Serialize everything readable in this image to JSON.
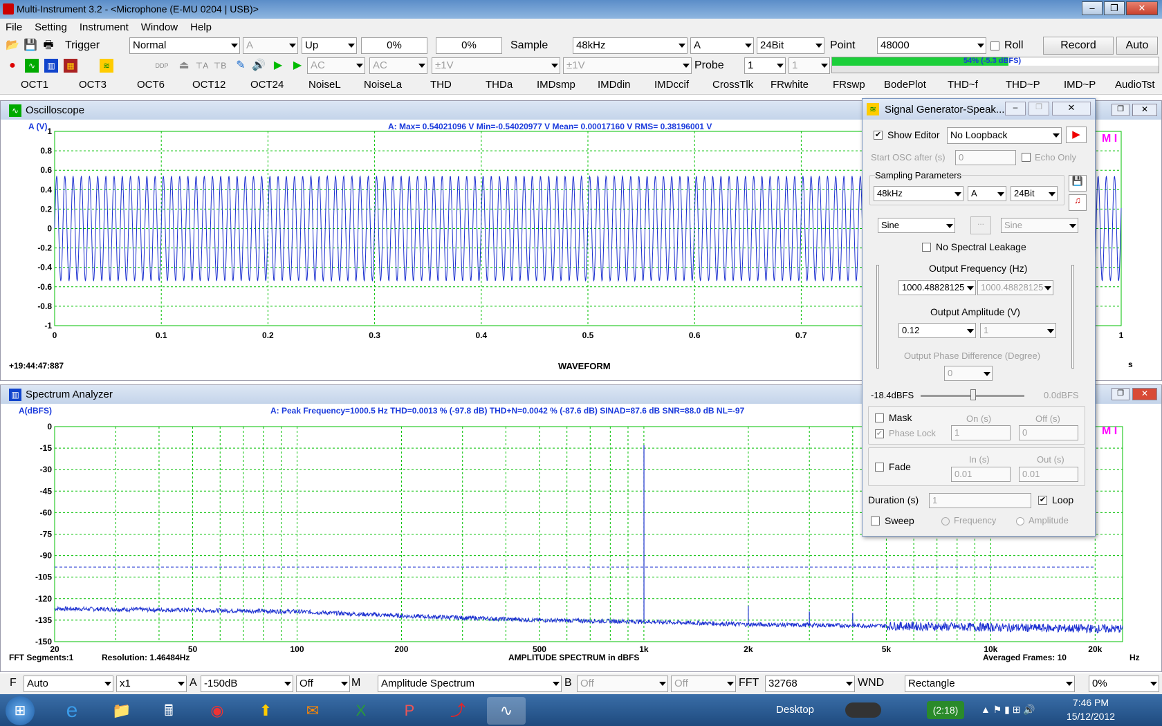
{
  "window": {
    "title": "Multi-Instrument 3.2   -   <Microphone (E-MU 0204 | USB)>"
  },
  "menu": [
    "File",
    "Setting",
    "Instrument",
    "Window",
    "Help"
  ],
  "toolbar1": {
    "trigger_label": "Trigger",
    "mode": "Normal",
    "channel": "A",
    "edge": "Up",
    "pct1": "0%",
    "pct2": "0%",
    "sample_label": "Sample",
    "sample_rate": "48kHz",
    "ch": "A",
    "bits": "24Bit",
    "point_label": "Point",
    "points": "48000",
    "roll_label": "Roll",
    "record_label": "Record",
    "auto_label": "Auto"
  },
  "toolbar2": {
    "coupling1": "AC",
    "coupling2": "AC",
    "range1": "±1V",
    "range2": "±1V",
    "probe_label": "Probe",
    "probe1": "1",
    "probe2": "1",
    "level_text": "54% (-5.3 dBFS)",
    "level": 0.54
  },
  "tabs": [
    "OCT1",
    "OCT3",
    "OCT6",
    "OCT12",
    "OCT24",
    "NoiseL",
    "NoiseLa",
    "THD",
    "THDa",
    "IMDsmp",
    "IMDdin",
    "IMDccif",
    "CrossTlk",
    "FRwhite",
    "FRswp",
    "BodePlot",
    "THD~f",
    "THD~P",
    "IMD~P",
    "AudioTst"
  ],
  "osc": {
    "title": "Oscilloscope",
    "yunit": "A (V)",
    "stats": "A: Max= 0.54021096 V   Min=-0.54020977 V   Mean= 0.00017160 V   RMS= 0.38196001 V",
    "timestamp": "+19:44:47:887",
    "xlabel": "WAVEFORM",
    "xunit": "s",
    "mi": "M I",
    "yticks": [
      "1",
      "0.8",
      "0.6",
      "0.4",
      "0.2",
      "0",
      "-0.2",
      "-0.4",
      "-0.6",
      "-0.8",
      "-1"
    ],
    "xticks": [
      "0",
      "0.1",
      "0.2",
      "0.3",
      "0.4",
      "0.5",
      "0.6",
      "0.7",
      "1"
    ]
  },
  "spec": {
    "title": "Spectrum Analyzer",
    "yunit": "A(dBFS)",
    "stats": "A: Peak Frequency=1000.5 Hz   THD=0.0013 % (-97.8 dB)   THD+N=0.0042 % (-87.6 dB)   SINAD=87.6 dB   SNR=88.0 dB   NL=-97",
    "fft_segments": "FFT Segments:1",
    "resolution": "Resolution: 1.46484Hz",
    "xlabel": "AMPLITUDE SPECTRUM in dBFS",
    "averaged": "Averaged Frames: 10",
    "xunit": "Hz",
    "mi": "M I",
    "yticks": [
      "0",
      "-15",
      "-30",
      "-45",
      "-60",
      "-75",
      "-90",
      "-105",
      "-120",
      "-135",
      "-150"
    ],
    "xticks": [
      "20",
      "50",
      "100",
      "200",
      "500",
      "1k",
      "2k",
      "5k",
      "10k",
      "20k"
    ]
  },
  "chart_data": [
    {
      "type": "line",
      "title": "WAVEFORM",
      "ylabel": "A (V)",
      "xlabel": "s",
      "ylim": [
        -1,
        1
      ],
      "xlim": [
        0,
        1
      ],
      "series": [
        {
          "name": "A",
          "frequency_hz": 1000.48828125,
          "amplitude_v": 0.5402
        }
      ]
    },
    {
      "type": "line",
      "title": "AMPLITUDE SPECTRUM in dBFS",
      "ylabel": "A(dBFS)",
      "xlabel": "Hz",
      "ylim": [
        -150,
        0
      ],
      "xlim": [
        20,
        24000
      ],
      "log_x": true,
      "series": [
        {
          "name": "A",
          "peaks": [
            {
              "x": 1000.5,
              "y": -13
            },
            {
              "x": 2000,
              "y": -125
            },
            {
              "x": 3000,
              "y": -129
            },
            {
              "x": 4000,
              "y": -130
            }
          ],
          "noise_floor": [
            {
              "x": 20,
              "y": -127
            },
            {
              "x": 50,
              "y": -128
            },
            {
              "x": 100,
              "y": -129
            },
            {
              "x": 200,
              "y": -132
            },
            {
              "x": 500,
              "y": -135
            },
            {
              "x": 1000,
              "y": -136
            },
            {
              "x": 2000,
              "y": -138
            },
            {
              "x": 5000,
              "y": -139
            },
            {
              "x": 10000,
              "y": -140
            },
            {
              "x": 20000,
              "y": -141
            }
          ]
        }
      ],
      "threshold_db": -98
    }
  ],
  "siggen": {
    "title": "Signal Generator-Speak...",
    "show_editor": "Show Editor",
    "loopback": "No Loopback",
    "start_osc": "Start OSC after (s)",
    "start_osc_val": "0",
    "echo_only": "Echo Only",
    "sampling_params": "Sampling Parameters",
    "rate": "48kHz",
    "ch": "A",
    "bits": "24Bit",
    "wave1": "Sine",
    "wave2": "Sine",
    "ellipsis": "...",
    "no_leak": "No Spectral Leakage",
    "out_freq": "Output Frequency (Hz)",
    "freq1": "1000.48828125",
    "freq2": "1000.48828125",
    "out_amp": "Output Amplitude (V)",
    "amp1": "0.12",
    "amp2": "1",
    "out_phase": "Output Phase Difference (Degree)",
    "phase": "0",
    "level_left": "-18.4dBFS",
    "level_right": "0.0dBFS",
    "mask": "Mask",
    "on_s": "On (s)",
    "off_s": "Off (s)",
    "phase_lock": "Phase Lock",
    "on_val": "1",
    "off_val": "0",
    "fade": "Fade",
    "in_s": "In (s)",
    "out_s": "Out (s)",
    "in_val": "0.01",
    "out_val": "0.01",
    "duration": "Duration (s)",
    "duration_val": "1",
    "loop": "Loop",
    "sweep": "Sweep",
    "frequency": "Frequency",
    "amplitude": "Amplitude"
  },
  "bottom": {
    "f_label": "F",
    "f_val": "Auto",
    "x_val": "x1",
    "a_label": "A",
    "a_val": "-150dB",
    "off1": "Off",
    "m_label": "M",
    "m_val": "Amplitude Spectrum",
    "b_label": "B",
    "b_val": "Off",
    "off2": "Off",
    "fft_label": "FFT",
    "fft_val": "32768",
    "wnd_label": "WND",
    "wnd_val": "Rectangle",
    "pct": "0%"
  },
  "taskbar": {
    "desktop": "Desktop",
    "battery": "(2:18)",
    "time": "7:46 PM",
    "date": "15/12/2012"
  }
}
